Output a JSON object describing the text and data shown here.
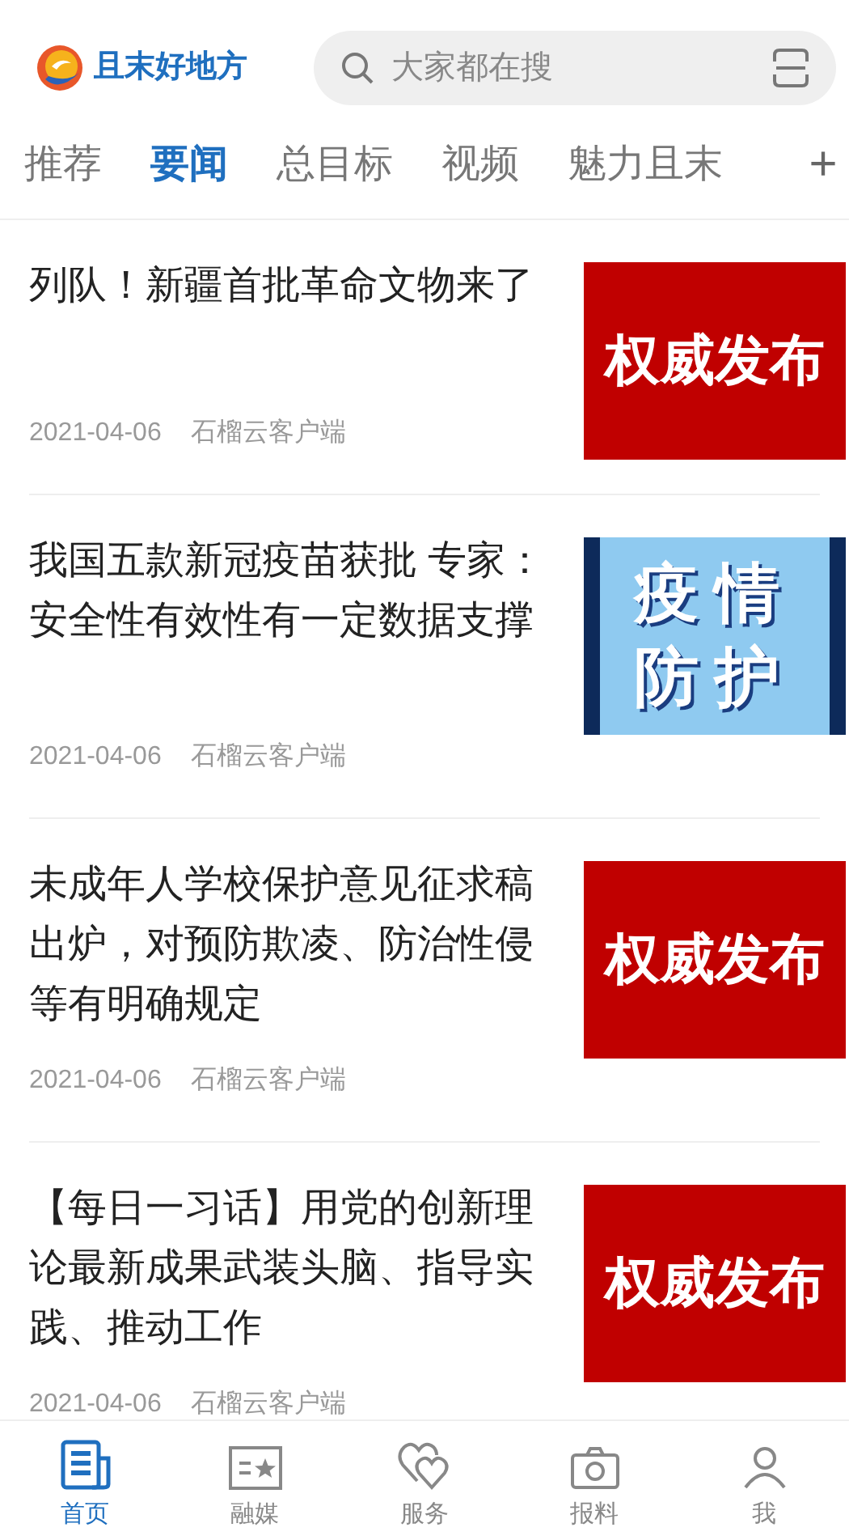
{
  "header": {
    "logo_text": "且末好地方",
    "search": {
      "placeholder": "大家都在搜"
    }
  },
  "tabs": [
    {
      "label": "推荐",
      "selected": false
    },
    {
      "label": "要闻",
      "selected": true
    },
    {
      "label": "总目标",
      "selected": false
    },
    {
      "label": "视频",
      "selected": false
    },
    {
      "label": "魅力且末",
      "selected": false
    }
  ],
  "add_tab": "+",
  "articles": [
    {
      "title": "列队！新疆首批革命文物来了",
      "date": "2021-04-06",
      "source": "石榴云客户端",
      "thumbnail": {
        "kind": "red",
        "lines": [
          "权威发布"
        ]
      }
    },
    {
      "title": "我国五款新冠疫苗获批 专家：安全性有效性有一定数据支撑",
      "date": "2021-04-06",
      "source": "石榴云客户端",
      "thumbnail": {
        "kind": "blue",
        "lines": [
          "疫情",
          "防护"
        ]
      }
    },
    {
      "title": "未成年人学校保护意见征求稿出炉，对预防欺凌、防治性侵等有明确规定",
      "date": "2021-04-06",
      "source": "石榴云客户端",
      "thumbnail": {
        "kind": "red",
        "lines": [
          "权威发布"
        ]
      }
    },
    {
      "title": "【每日一习话】用党的创新理论最新成果武装头脑、指导实践、推动工作",
      "date": "2021-04-06",
      "source": "石榴云客户端",
      "thumbnail": {
        "kind": "red",
        "lines": [
          "权威发布"
        ]
      }
    }
  ],
  "bottom_nav": [
    {
      "kind": "news",
      "label": "首页",
      "selected": true
    },
    {
      "kind": "media",
      "label": "融媒",
      "selected": false
    },
    {
      "kind": "service",
      "label": "服务",
      "selected": false
    },
    {
      "kind": "report",
      "label": "报料",
      "selected": false
    },
    {
      "kind": "me",
      "label": "我",
      "selected": false
    }
  ]
}
